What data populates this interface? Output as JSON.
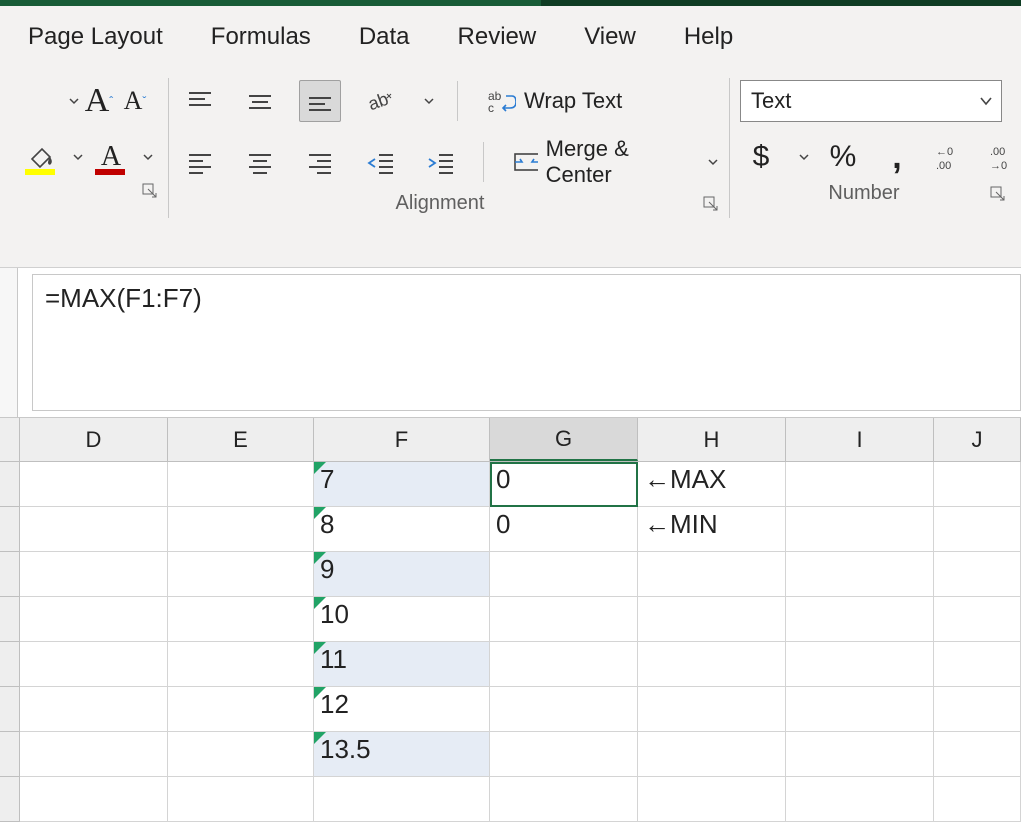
{
  "tabs": {
    "page_layout": "Page Layout",
    "formulas": "Formulas",
    "data": "Data",
    "review": "Review",
    "view": "View",
    "help": "Help"
  },
  "ribbon": {
    "wrap_text": "Wrap Text",
    "merge_center": "Merge & Center",
    "alignment_label": "Alignment",
    "number_label": "Number",
    "number_format": "Text",
    "currency_symbol": "$",
    "percent_symbol": "%",
    "comma_symbol": ","
  },
  "formula_bar": {
    "value": "=MAX(F1:F7)"
  },
  "columns": [
    "D",
    "E",
    "F",
    "G",
    "H",
    "I",
    "J"
  ],
  "selected_column": "G",
  "active_cell": "G1",
  "cells": {
    "F1": "7",
    "F2": "8",
    "F3": "9",
    "F4": "10",
    "F5": "11",
    "F6": "12",
    "F7": "13.5",
    "G1": "0",
    "G2": "0",
    "H1": "←MAX",
    "H2": "←MIN"
  }
}
